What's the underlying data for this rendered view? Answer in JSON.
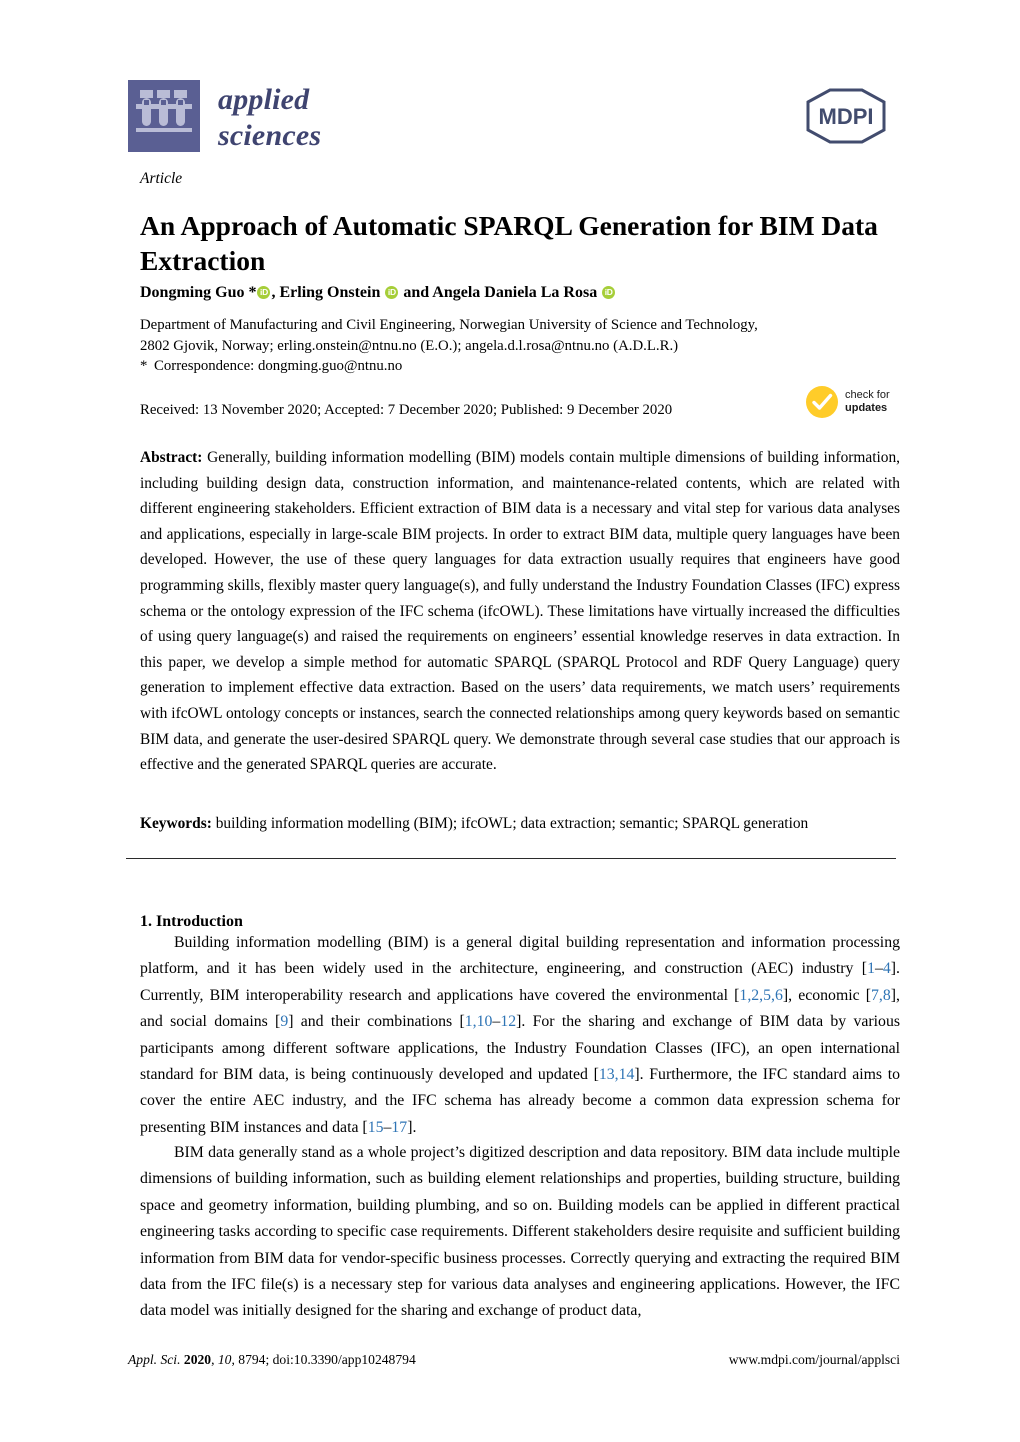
{
  "journal": {
    "name_line1": "applied",
    "name_line2": "sciences",
    "logo_icon": "test-tube-rack-icon",
    "publisher_logo_text": "MDPI"
  },
  "article": {
    "type": "Article",
    "title": "An Approach of Automatic SPARQL Generation for BIM Data Extraction",
    "authors_html": "Dongming Guo *{orcid}, Erling Onstein {orcid} and Angela Daniela La Rosa {orcid}",
    "orcid_label": "iD",
    "affiliation_line1": "Department of Manufacturing and Civil Engineering, Norwegian University of Science and Technology,",
    "affiliation_line2": "2802 Gjovik, Norway; erling.onstein@ntnu.no (E.O.); angela.d.l.rosa@ntnu.no (A.D.L.R.)",
    "correspondence_marker": "*",
    "correspondence": "Correspondence: dongming.guo@ntnu.no",
    "dates": "Received: 13 November 2020; Accepted: 7 December 2020; Published: 9 December 2020"
  },
  "crossmark": {
    "line1": "check for",
    "line2": "updates",
    "badge_color": "#FFCC29",
    "icon": "check-circle-icon"
  },
  "abstract": {
    "label": "Abstract:",
    "text": "Generally, building information modelling (BIM) models contain multiple dimensions of building information, including building design data, construction information, and maintenance-related contents, which are related with different engineering stakeholders. Efficient extraction of BIM data is a necessary and vital step for various data analyses and applications, especially in large-scale BIM projects. In order to extract BIM data, multiple query languages have been developed. However, the use of these query languages for data extraction usually requires that engineers have good programming skills, flexibly master query language(s), and fully understand the Industry Foundation Classes (IFC) express schema or the ontology expression of the IFC schema (ifcOWL). These limitations have virtually increased the difficulties of using query language(s) and raised the requirements on engineers’ essential knowledge reserves in data extraction. In this paper, we develop a simple method for automatic SPARQL (SPARQL Protocol and RDF Query Language) query generation to implement effective data extraction. Based on the users’ data requirements, we match users’ requirements with ifcOWL ontology concepts or instances, search the connected relationships among query keywords based on semantic BIM data, and generate the user-desired SPARQL query. We demonstrate through several case studies that our approach is effective and the generated SPARQL queries are accurate."
  },
  "keywords": {
    "label": "Keywords:",
    "text": "building information modelling (BIM); ifcOWL; data extraction; semantic; SPARQL generation"
  },
  "introduction": {
    "heading": "1. Introduction",
    "paragraph1_html": "Building information modelling (BIM) is a general digital building representation and information processing platform, and it has been widely used in the architecture, engineering, and construction (AEC) industry [<span class=\"ref\">1</span>–<span class=\"ref\">4</span>]. Currently, BIM interoperability research and applications have covered the environmental [<span class=\"ref\">1,2,5,6</span>], economic [<span class=\"ref\">7,8</span>], and social domains [<span class=\"ref\">9</span>] and their combinations [<span class=\"ref\">1,10</span>–<span class=\"ref\">12</span>]. For the sharing and exchange of BIM data by various participants among different software applications, the Industry Foundation Classes (IFC), an open international standard for BIM data, is being continuously developed and updated [<span class=\"ref\">13,14</span>]. Furthermore, the IFC standard aims to cover the entire AEC industry, and the IFC schema has already become a common data expression schema for presenting BIM instances and data [<span class=\"ref\">15</span>–<span class=\"ref\">17</span>].",
    "paragraph2_html": "BIM data generally stand as a whole project’s digitized description and data repository. BIM data include multiple dimensions of building information, such as building element relationships and properties, building structure, building space and geometry information, building plumbing, and so on. Building models can be applied in different practical engineering tasks according to specific case requirements. Different stakeholders desire requisite and sufficient building information from BIM data for vendor-specific business processes. Correctly querying and extracting the required BIM data from the IFC file(s) is a necessary step for various data analyses and engineering applications. However, the IFC data model was initially designed for the sharing and exchange of product data,"
  },
  "footer": {
    "citation_html": "<i>Appl. Sci.</i> <b>2020</b>, <i>10</i>, 8794; doi:10.3390/app10248794",
    "url": "www.mdpi.com/journal/applsci"
  },
  "colors": {
    "logo_purple": "#5a5f93",
    "orcid_green": "#A6CE39",
    "citation_blue": "#2E74B5",
    "mdpi_navy": "#424C6E"
  }
}
